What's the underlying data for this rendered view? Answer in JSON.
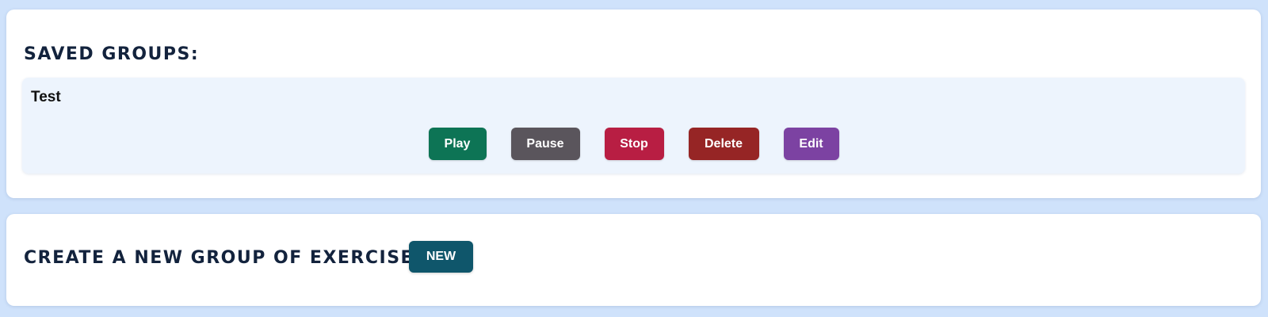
{
  "saved_groups": {
    "title": "SAVED GROUPS:",
    "groups": [
      {
        "name": "Test",
        "actions": {
          "play": "Play",
          "pause": "Pause",
          "stop": "Stop",
          "delete": "Delete",
          "edit": "Edit"
        }
      }
    ]
  },
  "create_group": {
    "title": "CREATE A NEW GROUP OF EXERCISES:",
    "new_label": "NEW"
  },
  "colors": {
    "page_background": "#cfe2fb",
    "card_background": "#ffffff",
    "group_background": "#edf4fd",
    "title_text": "#13233d",
    "play": "#0d7455",
    "pause": "#5a555c",
    "stop": "#b81e43",
    "delete": "#962525",
    "edit": "#7c42a2",
    "new": "#0f566b"
  }
}
